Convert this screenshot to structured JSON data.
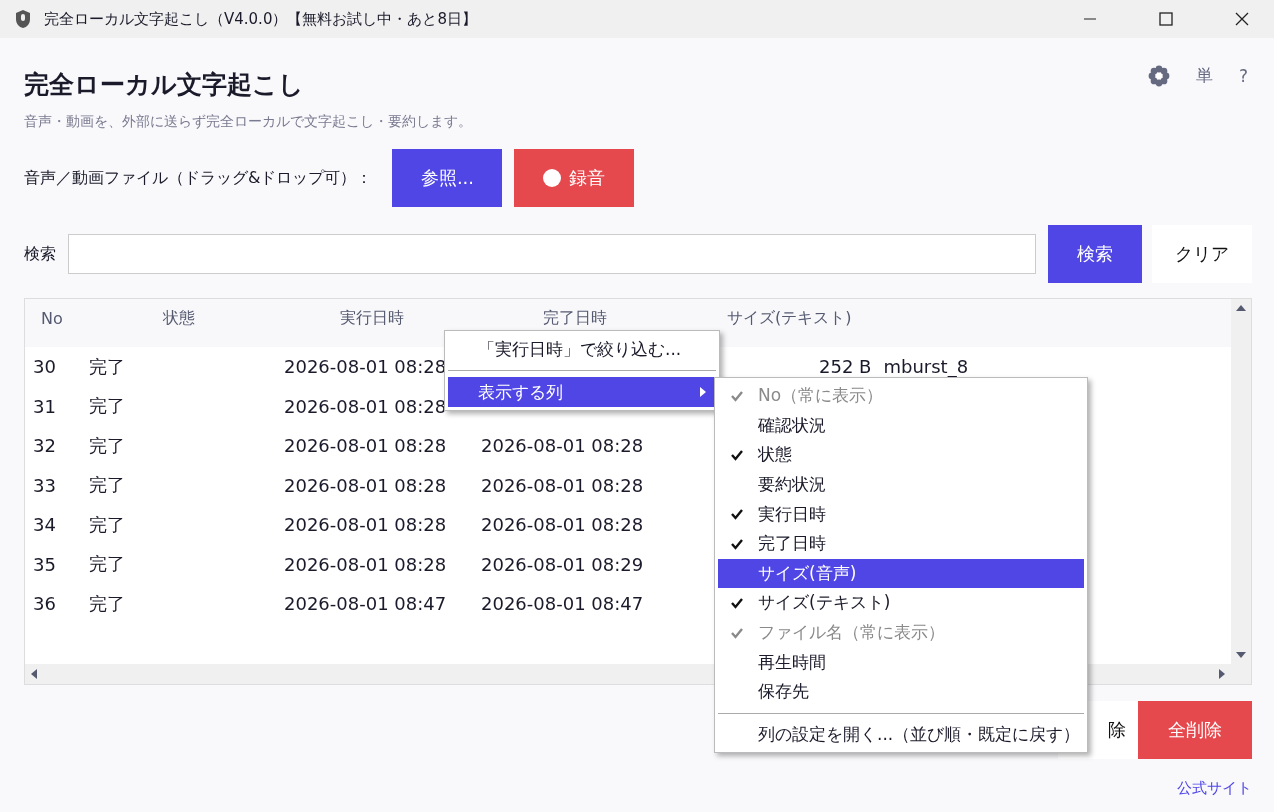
{
  "window": {
    "title": "完全ローカル文字起こし（V4.0.0）【無料お試し中・あと8日】"
  },
  "header": {
    "title": "完全ローカル文字起こし",
    "subtitle": "音声・動画を、外部に送らず完全ローカルで文字起こし・要約します。",
    "tool_labels": [
      "単",
      "?"
    ]
  },
  "file_row": {
    "label": "音声／動画ファイル（ドラッグ&ドロップ可）：",
    "browse_button": "参照...",
    "record_button": "録音"
  },
  "search": {
    "label": "検索",
    "search_button": "検索",
    "clear_button": "クリア"
  },
  "table": {
    "columns": [
      "No",
      "状態",
      "実行日時",
      "完了日時",
      "サイズ(テキスト)"
    ],
    "rows": [
      {
        "no": "30",
        "status": "完了",
        "executed": "2026-08-01 08:28",
        "size": "252 B",
        "file": "mburst_8"
      },
      {
        "no": "31",
        "status": "完了",
        "executed": "2026-08-01 08:28"
      },
      {
        "no": "32",
        "status": "完了",
        "executed": "2026-08-01 08:28",
        "completed": "2026-08-01 08:28"
      },
      {
        "no": "33",
        "status": "完了",
        "executed": "2026-08-01 08:28",
        "completed": "2026-08-01 08:28"
      },
      {
        "no": "34",
        "status": "完了",
        "executed": "2026-08-01 08:28",
        "completed": "2026-08-01 08:28"
      },
      {
        "no": "35",
        "status": "完了",
        "executed": "2026-08-01 08:28",
        "completed": "2026-08-01 08:29"
      },
      {
        "no": "36",
        "status": "完了",
        "executed": "2026-08-01 08:47",
        "completed": "2026-08-01 08:47"
      }
    ]
  },
  "bottom_buttons": [
    {
      "label": "除",
      "kind": "plain"
    },
    {
      "label": "全削除",
      "kind": "danger"
    }
  ],
  "link": "公式サイト",
  "context_menu": {
    "items": [
      {
        "label": "「実行日時」で絞り込む...",
        "kind": "item",
        "selected": false
      },
      {
        "label": "表示する列",
        "kind": "submenu",
        "selected": true
      }
    ]
  },
  "column_menu": {
    "items": [
      {
        "label": "No（常に表示）",
        "checked": true,
        "disabled": true,
        "selected": false
      },
      {
        "label": "確認状況",
        "checked": false,
        "disabled": false,
        "selected": false
      },
      {
        "label": "状態",
        "checked": true,
        "disabled": false,
        "selected": false
      },
      {
        "label": "要約状況",
        "checked": false,
        "disabled": false,
        "selected": false
      },
      {
        "label": "実行日時",
        "checked": true,
        "disabled": false,
        "selected": false
      },
      {
        "label": "完了日時",
        "checked": true,
        "disabled": false,
        "selected": false
      },
      {
        "label": "サイズ(音声)",
        "checked": false,
        "disabled": false,
        "selected": true
      },
      {
        "label": "サイズ(テキスト)",
        "checked": true,
        "disabled": false,
        "selected": false
      },
      {
        "label": "ファイル名（常に表示）",
        "checked": true,
        "disabled": true,
        "selected": false
      },
      {
        "label": "再生時間",
        "checked": false,
        "disabled": false,
        "selected": false
      },
      {
        "label": "保存先",
        "checked": false,
        "disabled": false,
        "selected": false
      }
    ],
    "footer": "列の設定を開く...（並び順・既定に戻す）"
  }
}
